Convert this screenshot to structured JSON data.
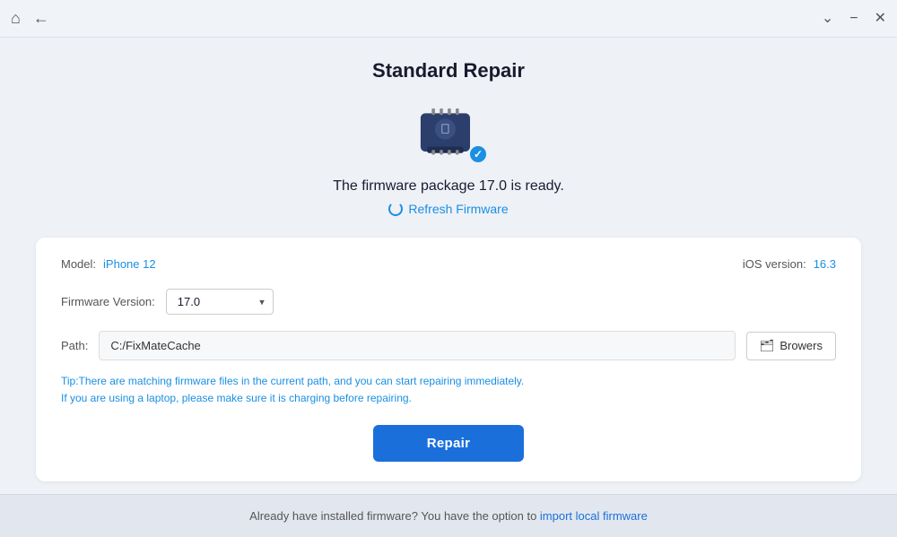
{
  "titlebar": {
    "home_icon": "⌂",
    "back_icon": "←",
    "chevron_icon": "⌄",
    "minimize_icon": "−",
    "close_icon": "✕"
  },
  "page": {
    "title": "Standard Repair",
    "firmware_ready_text": "The firmware package 17.0 is ready.",
    "refresh_firmware_label": "Refresh Firmware",
    "model_label": "Model:",
    "model_value": "iPhone 12",
    "ios_version_label": "iOS version:",
    "ios_version_value": "16.3",
    "firmware_version_label": "Firmware Version:",
    "firmware_version_value": "17.0",
    "path_label": "Path:",
    "path_value": "C:/FixMateCache",
    "browse_icon": "📁",
    "browse_label": "Browers",
    "tip_line1": "Tip:There are matching firmware files in the current path, and you can start repairing immediately.",
    "tip_line2": "If you are using a laptop, please make sure it is charging before repairing.",
    "repair_button_label": "Repair"
  },
  "footer": {
    "text": "Already have installed firmware? You have the option to ",
    "link_text": "import local firmware"
  }
}
